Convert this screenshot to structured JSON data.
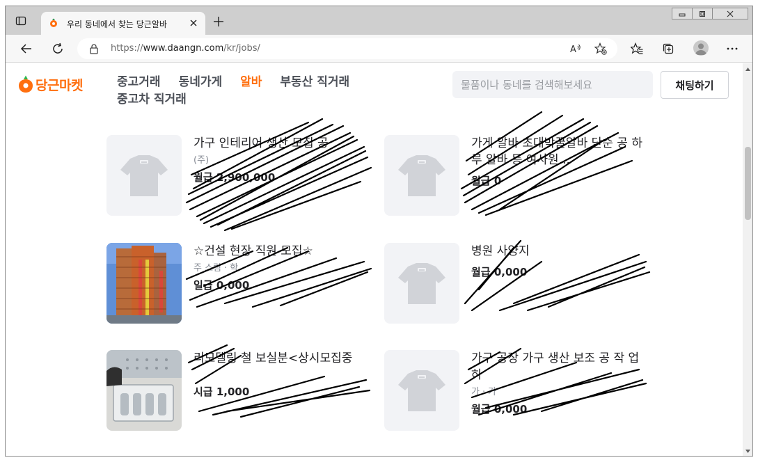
{
  "browser": {
    "tab_title": "우리 동네에서 찾는 당근알바",
    "url_prefix": "https://",
    "url_host": "www.daangn.com",
    "url_path": "/kr/jobs/"
  },
  "site": {
    "logo_text": "당근마켓",
    "brand_color": "#ff6f0f",
    "nav": [
      {
        "label": "중고거래"
      },
      {
        "label": "동네가게"
      },
      {
        "label": "알바"
      },
      {
        "label": "부동산 직거래"
      },
      {
        "label": "중고차 직거래"
      }
    ],
    "search_placeholder": "물품이나 동네를 검색해보세요",
    "chat_button": "채팅하기"
  },
  "jobs": [
    {
      "title": "가구 인테리어 생산 모집 공",
      "meta_a": "(주)",
      "meta_b": "",
      "pay": "월급 2,900,000",
      "thumb": "shirt"
    },
    {
      "title": "가게 알바 초대박꿀알바 단순 공 하루 알바 등 여사원...",
      "meta_a": "",
      "meta_b": "",
      "pay": "월급 0",
      "thumb": "shirt"
    },
    {
      "title": "☆건설 현장 직원 모집☆",
      "meta_a": "주 스림",
      "meta_b": "학",
      "pay": "일급 0,000",
      "thumb": "building"
    },
    {
      "title": "병원 사양지",
      "meta_a": "",
      "meta_b": "",
      "pay": "월급 0,000",
      "thumb": "shirt"
    },
    {
      "title": "리모델링 철 보실분<상시모집중",
      "meta_a": "",
      "meta_b": "",
      "pay": "시급 1,000",
      "thumb": "tray"
    },
    {
      "title": "가구 공장 가구 생산 보조 공 작 업 하 ",
      "meta_a": "가",
      "meta_b": "가",
      "pay": "월급 0,000",
      "thumb": "shirt"
    }
  ]
}
